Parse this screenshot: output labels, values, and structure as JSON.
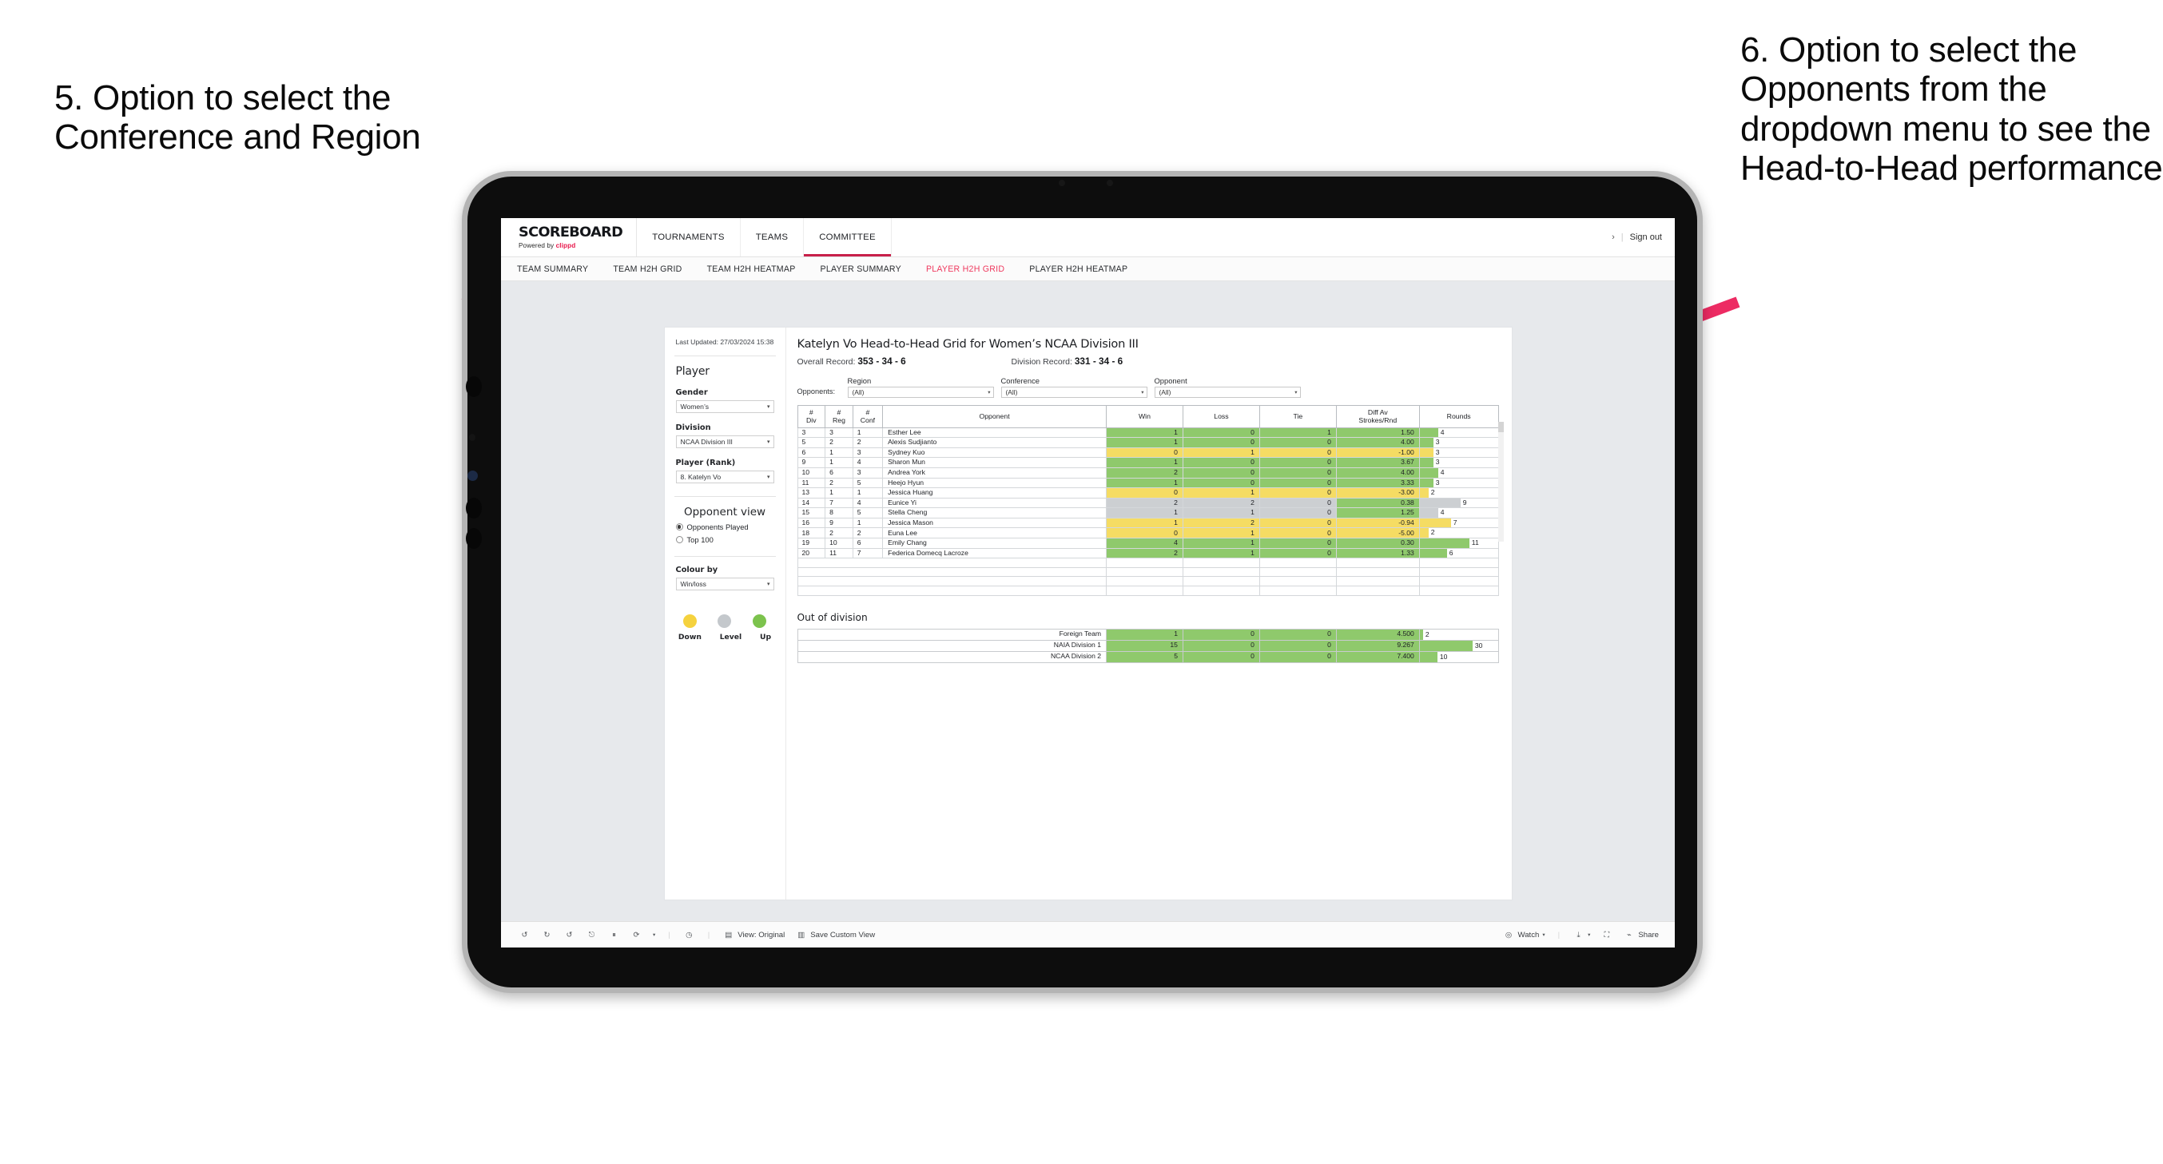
{
  "annotations": {
    "left": "5. Option to select the Conference and Region",
    "right": "6. Option to select the Opponents from the dropdown menu to see the Head-to-Head performance",
    "arrow_color": "#ED2B63"
  },
  "app": {
    "brand": {
      "title": "SCOREBOARD",
      "powered_prefix": "Powered by ",
      "powered_brand": "clippd"
    },
    "topnav": [
      {
        "label": "TOURNAMENTS",
        "active": false
      },
      {
        "label": "TEAMS",
        "active": false
      },
      {
        "label": "COMMITTEE",
        "active": true
      }
    ],
    "topnav_right": {
      "chevron": "›",
      "divider": "|",
      "signout": "Sign out"
    },
    "subnav": [
      {
        "label": "TEAM SUMMARY",
        "active": false
      },
      {
        "label": "TEAM H2H GRID",
        "active": false
      },
      {
        "label": "TEAM H2H HEATMAP",
        "active": false
      },
      {
        "label": "PLAYER SUMMARY",
        "active": false
      },
      {
        "label": "PLAYER H2H GRID",
        "active": true
      },
      {
        "label": "PLAYER H2H HEATMAP",
        "active": false
      }
    ],
    "accent": "#EF3A5F",
    "active_tab_underline": "#C8204A"
  },
  "sidebar": {
    "last_updated": "Last Updated: 27/03/2024 15:38",
    "player_heading": "Player",
    "gender_label": "Gender",
    "gender_value": "Women’s",
    "division_label": "Division",
    "division_value": "NCAA Division III",
    "player_rank_label": "Player (Rank)",
    "player_rank_value": "8. Katelyn Vo",
    "opponent_view_heading": "Opponent view",
    "opponent_view_options": [
      {
        "label": "Opponents Played",
        "selected": true
      },
      {
        "label": "Top 100",
        "selected": false
      }
    ],
    "colour_by_label": "Colour by",
    "colour_by_value": "Win/loss",
    "legend": [
      {
        "label": "Down",
        "color": "#F5D23E"
      },
      {
        "label": "Level",
        "color": "#C4C8CC"
      },
      {
        "label": "Up",
        "color": "#7CC34D"
      }
    ]
  },
  "viz": {
    "title": "Katelyn Vo Head-to-Head Grid for Women’s NCAA Division III",
    "overall_record_label": "Overall Record:",
    "overall_record_value": "353 - 34 - 6",
    "division_record_label": "Division Record:",
    "division_record_value": "331 - 34 - 6",
    "filters_label": "Opponents:",
    "filters": [
      {
        "name": "Region",
        "value": "(All)"
      },
      {
        "name": "Conference",
        "value": "(All)"
      },
      {
        "name": "Opponent",
        "value": "(All)"
      }
    ],
    "out_of_division_title": "Out of division"
  },
  "chart_data": {
    "type": "table",
    "title": "Katelyn Vo Head-to-Head Grid for Women’s NCAA Division III",
    "columns": [
      "# Div",
      "# Reg",
      "# Conf",
      "Opponent",
      "Win",
      "Loss",
      "Tie",
      "Diff Av Strokes/Rnd",
      "Rounds"
    ],
    "column_headers_multiline": [
      {
        "l1": "#",
        "l2": "Div"
      },
      {
        "l1": "#",
        "l2": "Reg"
      },
      {
        "l1": "#",
        "l2": "Conf"
      },
      {
        "l1": "Opponent",
        "l2": ""
      },
      {
        "l1": "Win",
        "l2": ""
      },
      {
        "l1": "Loss",
        "l2": ""
      },
      {
        "l1": "Tie",
        "l2": ""
      },
      {
        "l1": "Diff Av",
        "l2": "Strokes/Rnd"
      },
      {
        "l1": "Rounds",
        "l2": ""
      }
    ],
    "rows": [
      {
        "div": "3",
        "reg": "3",
        "conf": "1",
        "opponent": "Esther Lee",
        "win": "1",
        "loss": "0",
        "tie": "1",
        "diff": "1.50",
        "rounds": "4",
        "rounds_n": 4,
        "color": "green"
      },
      {
        "div": "5",
        "reg": "2",
        "conf": "2",
        "opponent": "Alexis Sudjianto",
        "win": "1",
        "loss": "0",
        "tie": "0",
        "diff": "4.00",
        "rounds": "3",
        "rounds_n": 3,
        "color": "green"
      },
      {
        "div": "6",
        "reg": "1",
        "conf": "3",
        "opponent": "Sydney Kuo",
        "win": "0",
        "loss": "1",
        "tie": "0",
        "diff": "-1.00",
        "rounds": "3",
        "rounds_n": 3,
        "color": "yellow"
      },
      {
        "div": "9",
        "reg": "1",
        "conf": "4",
        "opponent": "Sharon Mun",
        "win": "1",
        "loss": "0",
        "tie": "0",
        "diff": "3.67",
        "rounds": "3",
        "rounds_n": 3,
        "color": "green"
      },
      {
        "div": "10",
        "reg": "6",
        "conf": "3",
        "opponent": "Andrea York",
        "win": "2",
        "loss": "0",
        "tie": "0",
        "diff": "4.00",
        "rounds": "4",
        "rounds_n": 4,
        "color": "green"
      },
      {
        "div": "11",
        "reg": "2",
        "conf": "5",
        "opponent": "Heejo Hyun",
        "win": "1",
        "loss": "0",
        "tie": "0",
        "diff": "3.33",
        "rounds": "3",
        "rounds_n": 3,
        "color": "green"
      },
      {
        "div": "13",
        "reg": "1",
        "conf": "1",
        "opponent": "Jessica Huang",
        "win": "0",
        "loss": "1",
        "tie": "0",
        "diff": "-3.00",
        "rounds": "2",
        "rounds_n": 2,
        "color": "yellow"
      },
      {
        "div": "14",
        "reg": "7",
        "conf": "4",
        "opponent": "Eunice Yi",
        "win": "2",
        "loss": "2",
        "tie": "0",
        "diff": "0.38",
        "rounds": "9",
        "rounds_n": 9,
        "color": "grey",
        "diff_color": "green"
      },
      {
        "div": "15",
        "reg": "8",
        "conf": "5",
        "opponent": "Stella Cheng",
        "win": "1",
        "loss": "1",
        "tie": "0",
        "diff": "1.25",
        "rounds": "4",
        "rounds_n": 4,
        "color": "grey",
        "diff_color": "green"
      },
      {
        "div": "16",
        "reg": "9",
        "conf": "1",
        "opponent": "Jessica Mason",
        "win": "1",
        "loss": "2",
        "tie": "0",
        "diff": "-0.94",
        "rounds": "7",
        "rounds_n": 7,
        "color": "yellow"
      },
      {
        "div": "18",
        "reg": "2",
        "conf": "2",
        "opponent": "Euna Lee",
        "win": "0",
        "loss": "1",
        "tie": "0",
        "diff": "-5.00",
        "rounds": "2",
        "rounds_n": 2,
        "color": "yellow"
      },
      {
        "div": "19",
        "reg": "10",
        "conf": "6",
        "opponent": "Emily Chang",
        "win": "4",
        "loss": "1",
        "tie": "0",
        "diff": "0.30",
        "rounds": "11",
        "rounds_n": 11,
        "color": "green"
      },
      {
        "div": "20",
        "reg": "11",
        "conf": "7",
        "opponent": "Federica Domecq Lacroze",
        "win": "2",
        "loss": "1",
        "tie": "0",
        "diff": "1.33",
        "rounds": "6",
        "rounds_n": 6,
        "color": "green"
      }
    ],
    "rounds_max": 11,
    "out_of_division": {
      "rows": [
        {
          "name": "Foreign Team",
          "win": "1",
          "loss": "0",
          "tie": "0",
          "diff": "4.500",
          "rounds": "2",
          "rounds_n": 2,
          "color": "green"
        },
        {
          "name": "NAIA Division 1",
          "win": "15",
          "loss": "0",
          "tie": "0",
          "diff": "9.267",
          "rounds": "30",
          "rounds_n": 30,
          "color": "green"
        },
        {
          "name": "NCAA Division 2",
          "win": "5",
          "loss": "0",
          "tie": "0",
          "diff": "7.400",
          "rounds": "10",
          "rounds_n": 10,
          "color": "green"
        }
      ],
      "rounds_max": 30
    },
    "colors": {
      "green": "#8FC96C",
      "yellow": "#F5DC63",
      "grey": "#CCCFD2",
      "white": "#FFFFFF"
    }
  },
  "toolbar": {
    "icons_left": [
      "undo-icon",
      "redo-icon",
      "revert-icon",
      "refresh-icon",
      "pause-icon",
      "loop-icon"
    ],
    "view_original": "View: Original",
    "save_custom_view": "Save Custom View",
    "watch": "Watch",
    "share": "Share"
  }
}
